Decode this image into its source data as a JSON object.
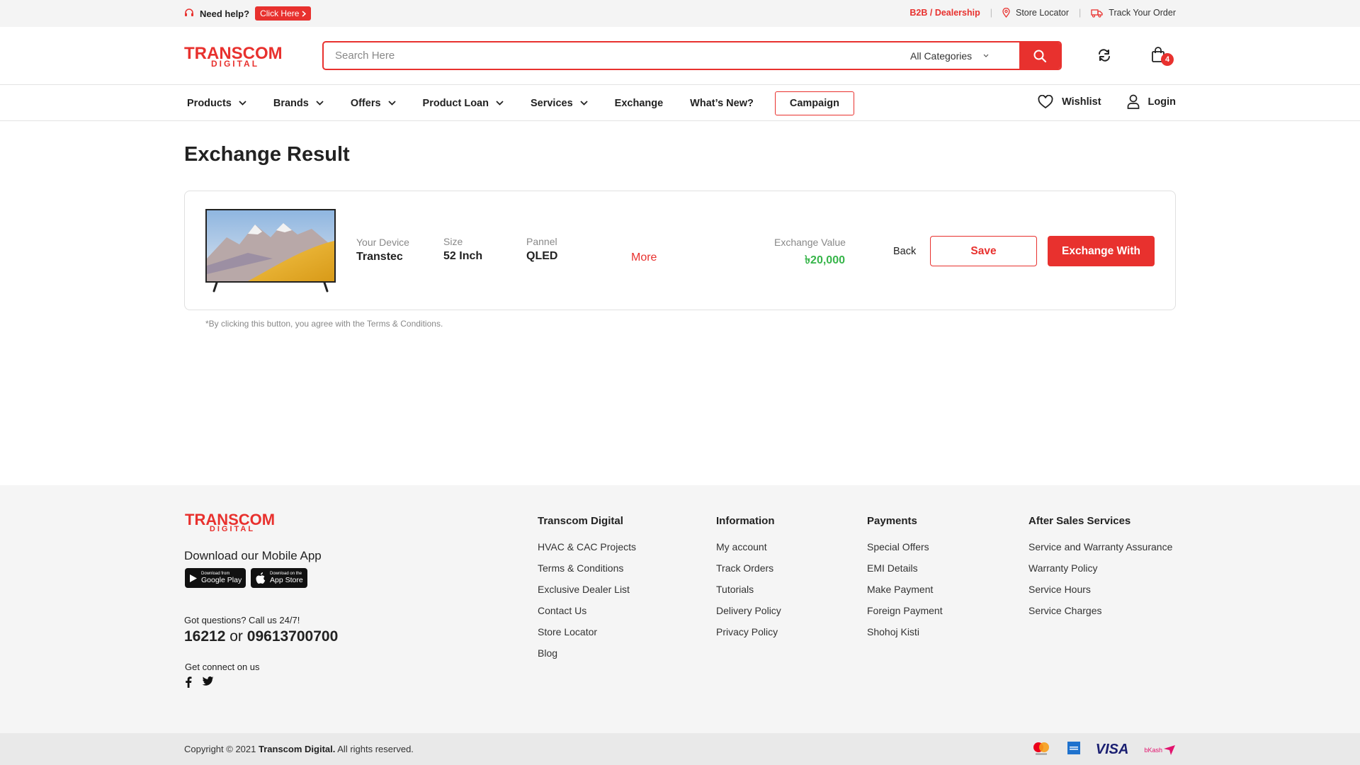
{
  "topbar": {
    "help_label": "Need help?",
    "click_here": "Click Here",
    "b2b": "B2B / Dealership",
    "store_locator": "Store Locator",
    "track_order": "Track Your Order"
  },
  "header": {
    "logo_main": "TRANSCOM",
    "logo_sub": "DIGITAL",
    "search_placeholder": "Search Here",
    "category": "All Categories",
    "cart_count": "4"
  },
  "nav": {
    "items": [
      {
        "label": "Products",
        "dropdown": true
      },
      {
        "label": "Brands",
        "dropdown": true
      },
      {
        "label": "Offers",
        "dropdown": true
      },
      {
        "label": "Product Loan",
        "dropdown": true
      },
      {
        "label": "Services",
        "dropdown": true
      },
      {
        "label": "Exchange",
        "dropdown": false
      },
      {
        "label": "What’s New?",
        "dropdown": false
      }
    ],
    "campaign": "Campaign",
    "wishlist": "Wishlist",
    "login": "Login"
  },
  "main": {
    "title": "Exchange Result",
    "device_label": "Your Device",
    "device_value": "Transtec",
    "size_label": "Size",
    "size_value": "52 Inch",
    "panel_label": "Pannel",
    "panel_value": "QLED",
    "more": "More",
    "exchange_value_label": "Exchange Value",
    "exchange_value": "৳20,000",
    "back": "Back",
    "save": "Save",
    "exchange_with": "Exchange With",
    "note": "*By clicking this button, you agree with the Terms & Conditions."
  },
  "footer": {
    "logo_main": "TRANSCOM",
    "logo_sub": "DIGITAL",
    "app_title": "Download our Mobile App",
    "google_small": "Download from",
    "google_big": "Google Play",
    "apple_small": "Download on the",
    "apple_big": "App Store",
    "questions": "Got questions? Call us 24/7!",
    "phone1": "16212",
    "phone_or": "or",
    "phone2": "09613700700",
    "connect": "Get connect on us",
    "columns": [
      {
        "title": "Transcom Digital",
        "items": [
          "HVAC & CAC Projects",
          "Terms & Conditions",
          "Exclusive Dealer List",
          "Contact Us",
          "Store Locator",
          "Blog"
        ]
      },
      {
        "title": "Information",
        "items": [
          "My account",
          "Track Orders",
          "Tutorials",
          "Delivery Policy",
          "Privacy Policy"
        ]
      },
      {
        "title": "Payments",
        "items": [
          "Special Offers",
          "EMI Details",
          "Make Payment",
          "Foreign Payment",
          "Shohoj Kisti"
        ]
      },
      {
        "title": "After Sales Services",
        "items": [
          "Service and Warranty Assurance",
          "Warranty Policy",
          "Service Hours",
          "Service Charges"
        ]
      }
    ],
    "copyright_pre": "Copyright © 2021",
    "copyright_brand": "Transcom Digital.",
    "copyright_post": "All rights reserved.",
    "payment_visa": "VISA",
    "payment_bkash": "bKash"
  },
  "colors": {
    "accent": "#e8312e",
    "value_green": "#37b54a"
  }
}
